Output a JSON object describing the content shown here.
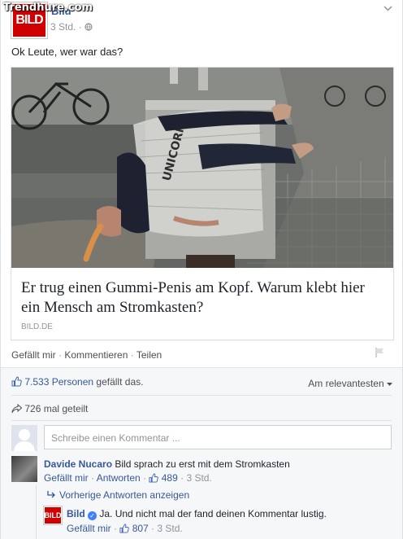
{
  "watermark": "Trendhure.com",
  "post": {
    "logo_text": "BILD",
    "page_name": "Bild",
    "time": "3 Std. ·",
    "globe_icon": "globe-icon",
    "text": "Ok Leute, wer war das?"
  },
  "link": {
    "headline": "Er trug einen Gummi-Penis am Kopf. Warum klebt hier ein Mensch am Stromkasten?",
    "domain": "BILD.DE",
    "image_tape_text": "UNICORN"
  },
  "actions": {
    "like": "Gefällt mir",
    "comment": "Kommentieren",
    "share": "Teilen",
    "sep": " · "
  },
  "ufi": {
    "likes_count": "7.533 Personen",
    "likes_suffix": " gefällt das.",
    "sort_label": "Am relevantesten",
    "shares": "726 mal geteilt",
    "comment_placeholder": "Schreibe einen Kommentar ..."
  },
  "comments": [
    {
      "author": "Davide Nucaro",
      "text": " Bild sprach zu erst mit dem Stromkasten",
      "like": "Gefällt mir",
      "reply": "Antworten",
      "likes": "489",
      "time": "3 Std."
    }
  ],
  "prev_replies": "Vorherige Antworten anzeigen",
  "reply": {
    "logo_text": "BILD",
    "author": "Bild",
    "text": " Ja. Und nicht mal der fand deinen Kommentar lustig.",
    "like": "Gefällt mir",
    "likes": "807",
    "time": "3 Std."
  },
  "colors": {
    "link_blue": "#365899",
    "brand_red": "#d00000",
    "meta_gray": "#90949c"
  }
}
